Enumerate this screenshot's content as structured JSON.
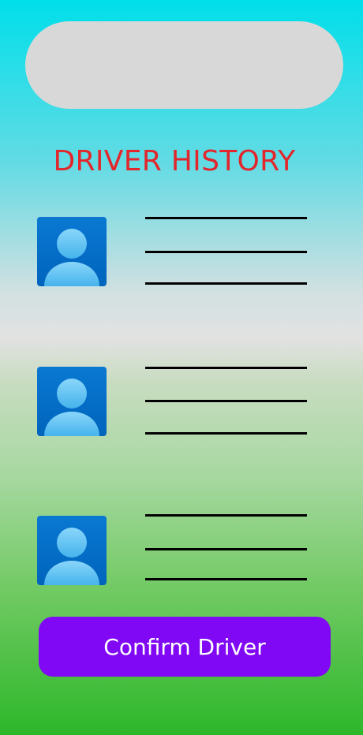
{
  "header": {
    "search_bar_value": ""
  },
  "page": {
    "title": "DRIVER HISTORY"
  },
  "drivers": [
    {
      "avatar_icon": "person-icon"
    },
    {
      "avatar_icon": "person-icon"
    },
    {
      "avatar_icon": "person-icon"
    }
  ],
  "actions": {
    "confirm_label": "Confirm Driver"
  },
  "colors": {
    "title": "#e2262b",
    "confirm_button": "#8008f4",
    "top_bar": "#d8d8d8",
    "avatar_bg": "#006ec8",
    "avatar_figure": "#6cc4f4"
  }
}
